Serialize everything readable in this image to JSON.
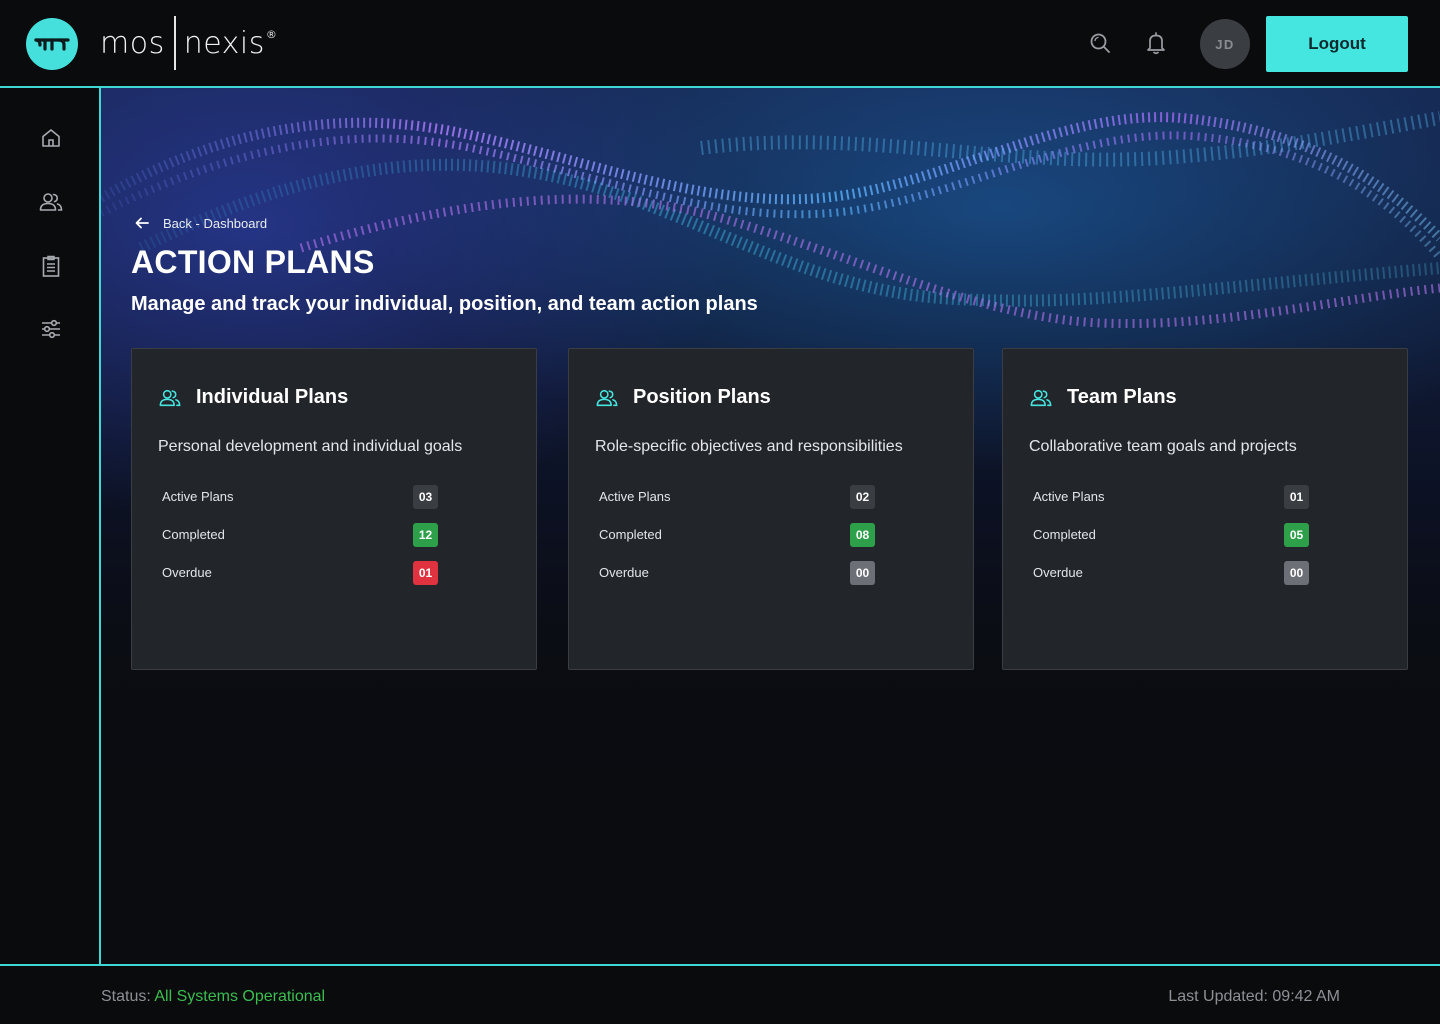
{
  "header": {
    "brand_left": "mos",
    "brand_right": "nexis",
    "brand_reg": "®",
    "avatar_initials": "JD",
    "logout_label": "Logout",
    "icons": [
      "search-icon",
      "bell-icon"
    ]
  },
  "sidebar": {
    "items": [
      {
        "name": "home",
        "icon": "home-icon"
      },
      {
        "name": "users",
        "icon": "users-icon"
      },
      {
        "name": "clipboard",
        "icon": "clipboard-icon"
      },
      {
        "name": "settings",
        "icon": "sliders-icon"
      }
    ]
  },
  "page": {
    "back_label": "Back - Dashboard",
    "title": "ACTION PLANS",
    "subtitle": "Manage and track your individual, position, and team action plans"
  },
  "cards": [
    {
      "title": "Individual Plans",
      "description": "Personal development and individual goals",
      "stats": [
        {
          "label": "Active Plans",
          "value": "03",
          "color": "#3a3d42"
        },
        {
          "label": "Completed",
          "value": "12",
          "color": "#2ea04a"
        },
        {
          "label": "Overdue",
          "value": "01",
          "color": "#e0323f"
        }
      ]
    },
    {
      "title": "Position Plans",
      "description": "Role-specific objectives and responsibilities",
      "stats": [
        {
          "label": "Active Plans",
          "value": "02",
          "color": "#3a3d42"
        },
        {
          "label": "Completed",
          "value": "08",
          "color": "#2ea04a"
        },
        {
          "label": "Overdue",
          "value": "00",
          "color": "#6c7076"
        }
      ]
    },
    {
      "title": "Team Plans",
      "description": "Collaborative team goals and projects",
      "stats": [
        {
          "label": "Active Plans",
          "value": "01",
          "color": "#3a3d42"
        },
        {
          "label": "Completed",
          "value": "05",
          "color": "#2ea04a"
        },
        {
          "label": "Overdue",
          "value": "00",
          "color": "#6c7076"
        }
      ]
    }
  ],
  "footer": {
    "status_label": "Status:",
    "status_value": "All Systems Operational",
    "last_updated": "Last Updated: 09:42 AM"
  },
  "colors": {
    "accent": "#45e5e0",
    "success": "#2ea04a",
    "danger": "#e0323f",
    "neutral": "#6c7076"
  }
}
